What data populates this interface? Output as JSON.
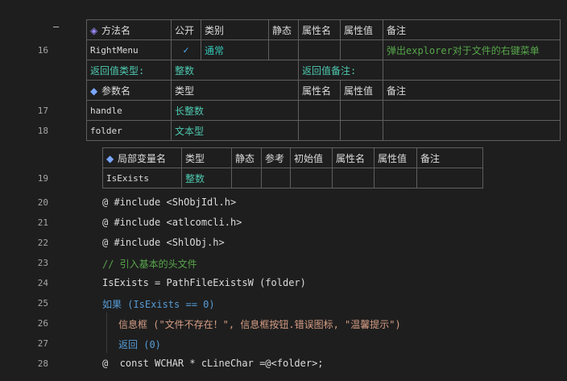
{
  "method_table": {
    "headers": [
      "方法名",
      "公开",
      "类别",
      "静态",
      "属性名",
      "属性值",
      "备注"
    ],
    "row": {
      "line": "16",
      "name": "RightMenu",
      "public": "✓",
      "category": "通常",
      "static": "",
      "attr_name": "",
      "attr_value": "",
      "note": "弹出explorer对于文件的右键菜单"
    },
    "return_type_label": "返回值类型:",
    "return_type": "整数",
    "return_note_label": "返回值备注:"
  },
  "param_table": {
    "headers": [
      "参数名",
      "类型",
      "属性名",
      "属性值",
      "备注"
    ],
    "rows": [
      {
        "line": "17",
        "name": "handle",
        "type": "长整数"
      },
      {
        "line": "18",
        "name": "folder",
        "type": "文本型"
      }
    ]
  },
  "local_table": {
    "headers": [
      "局部变量名",
      "类型",
      "静态",
      "参考",
      "初始值",
      "属性名",
      "属性值",
      "备注"
    ],
    "row": {
      "line": "19",
      "name": "IsExists",
      "type": "整数"
    }
  },
  "fold_marker": "—",
  "code_lines": [
    {
      "line": "20",
      "text": "@ #include <ShObjIdl.h>"
    },
    {
      "line": "21",
      "text": "@ #include <atlcomcli.h>"
    },
    {
      "line": "22",
      "text": "@ #include <ShlObj.h>"
    },
    {
      "line": "23",
      "text": "// 引入基本的头文件"
    },
    {
      "line": "24",
      "text": "IsExists = PathFileExistsW (folder)"
    },
    {
      "line": "25",
      "text": "如果 (IsExists == 0)"
    },
    {
      "line": "26",
      "text": "信息框 (\"文件不存在！\", 信息框按钮.错误图标, \"温馨提示\")"
    },
    {
      "line": "27",
      "text": "返回 (0)"
    },
    {
      "line": "28",
      "text": "@  const WCHAR * cLineChar =@<folder>;"
    }
  ],
  "colors": {
    "background": "#1e1e1e",
    "type_green": "#4ec9b0",
    "note_green": "#57a64a",
    "keyword_blue": "#569cd6",
    "string": "#d69d85",
    "purple_string": "#c586c0"
  }
}
